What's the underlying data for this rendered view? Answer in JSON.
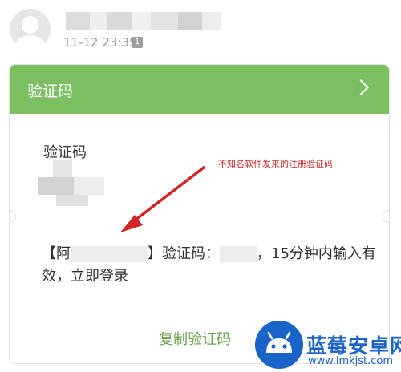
{
  "header": {
    "timestamp": "11-12 23:35",
    "sim_badge": "1"
  },
  "card": {
    "title": "验证码",
    "chevron_icon": "chevron-right-icon",
    "code_label": "验证码",
    "message_prefix": "【阿",
    "message_mid": "】验证码：",
    "message_suffix": "，15分钟内输入有效，立即登录",
    "copy_label": "复制验证码"
  },
  "annotation": {
    "text": "不知名软件发来的注册验证码",
    "color": "#d32525"
  },
  "watermark": {
    "title": "蓝莓安卓网",
    "url": "www.lmkjst.com",
    "logo_icon": "android-bot-icon"
  },
  "colors": {
    "header_green": "#7cbf61",
    "copy_green": "#6aa24a"
  }
}
